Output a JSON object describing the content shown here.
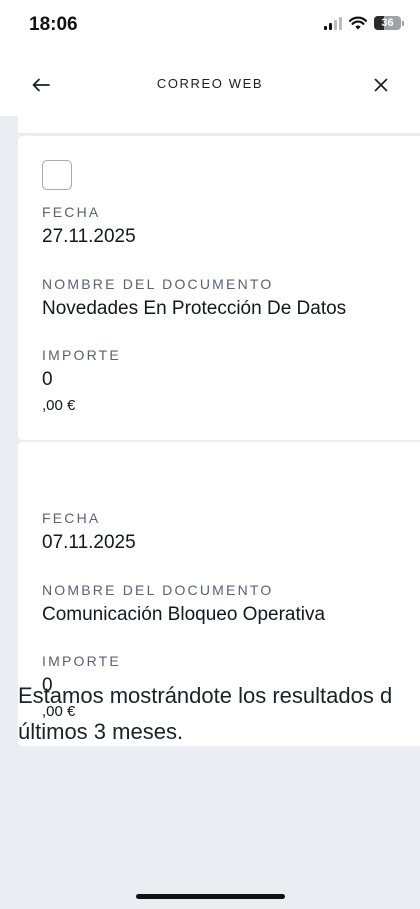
{
  "status_bar": {
    "time": "18:06",
    "battery": "36",
    "icons": [
      "signal-icon",
      "wifi-icon",
      "battery-icon"
    ]
  },
  "header": {
    "title": "CORREO WEB",
    "back_icon": "arrow-left-icon",
    "close_icon": "close-icon"
  },
  "documents": [
    {
      "fecha_label": "FECHA",
      "fecha": "27.11.2025",
      "nombre_label": "NOMBRE DEL DOCUMENTO",
      "nombre": "Novedades En Protección De Datos",
      "importe_label": "IMPORTE",
      "importe_int": "0",
      "importe_dec": ",00 €",
      "has_checkbox": true
    },
    {
      "fecha_label": "FECHA",
      "fecha": "07.11.2025",
      "nombre_label": "NOMBRE DEL DOCUMENTO",
      "nombre": "Comunicación Bloqueo Operativa",
      "importe_label": "IMPORTE",
      "importe_int": "0",
      "importe_dec": ",00 €",
      "has_checkbox": false
    }
  ],
  "info": {
    "line1": "Estamos mostrándote los resultados d",
    "line2": "últimos 3 meses."
  },
  "colors": {
    "background": "#ebedf3",
    "card": "#ffffff",
    "label": "#5a6178",
    "text": "#14171f"
  }
}
